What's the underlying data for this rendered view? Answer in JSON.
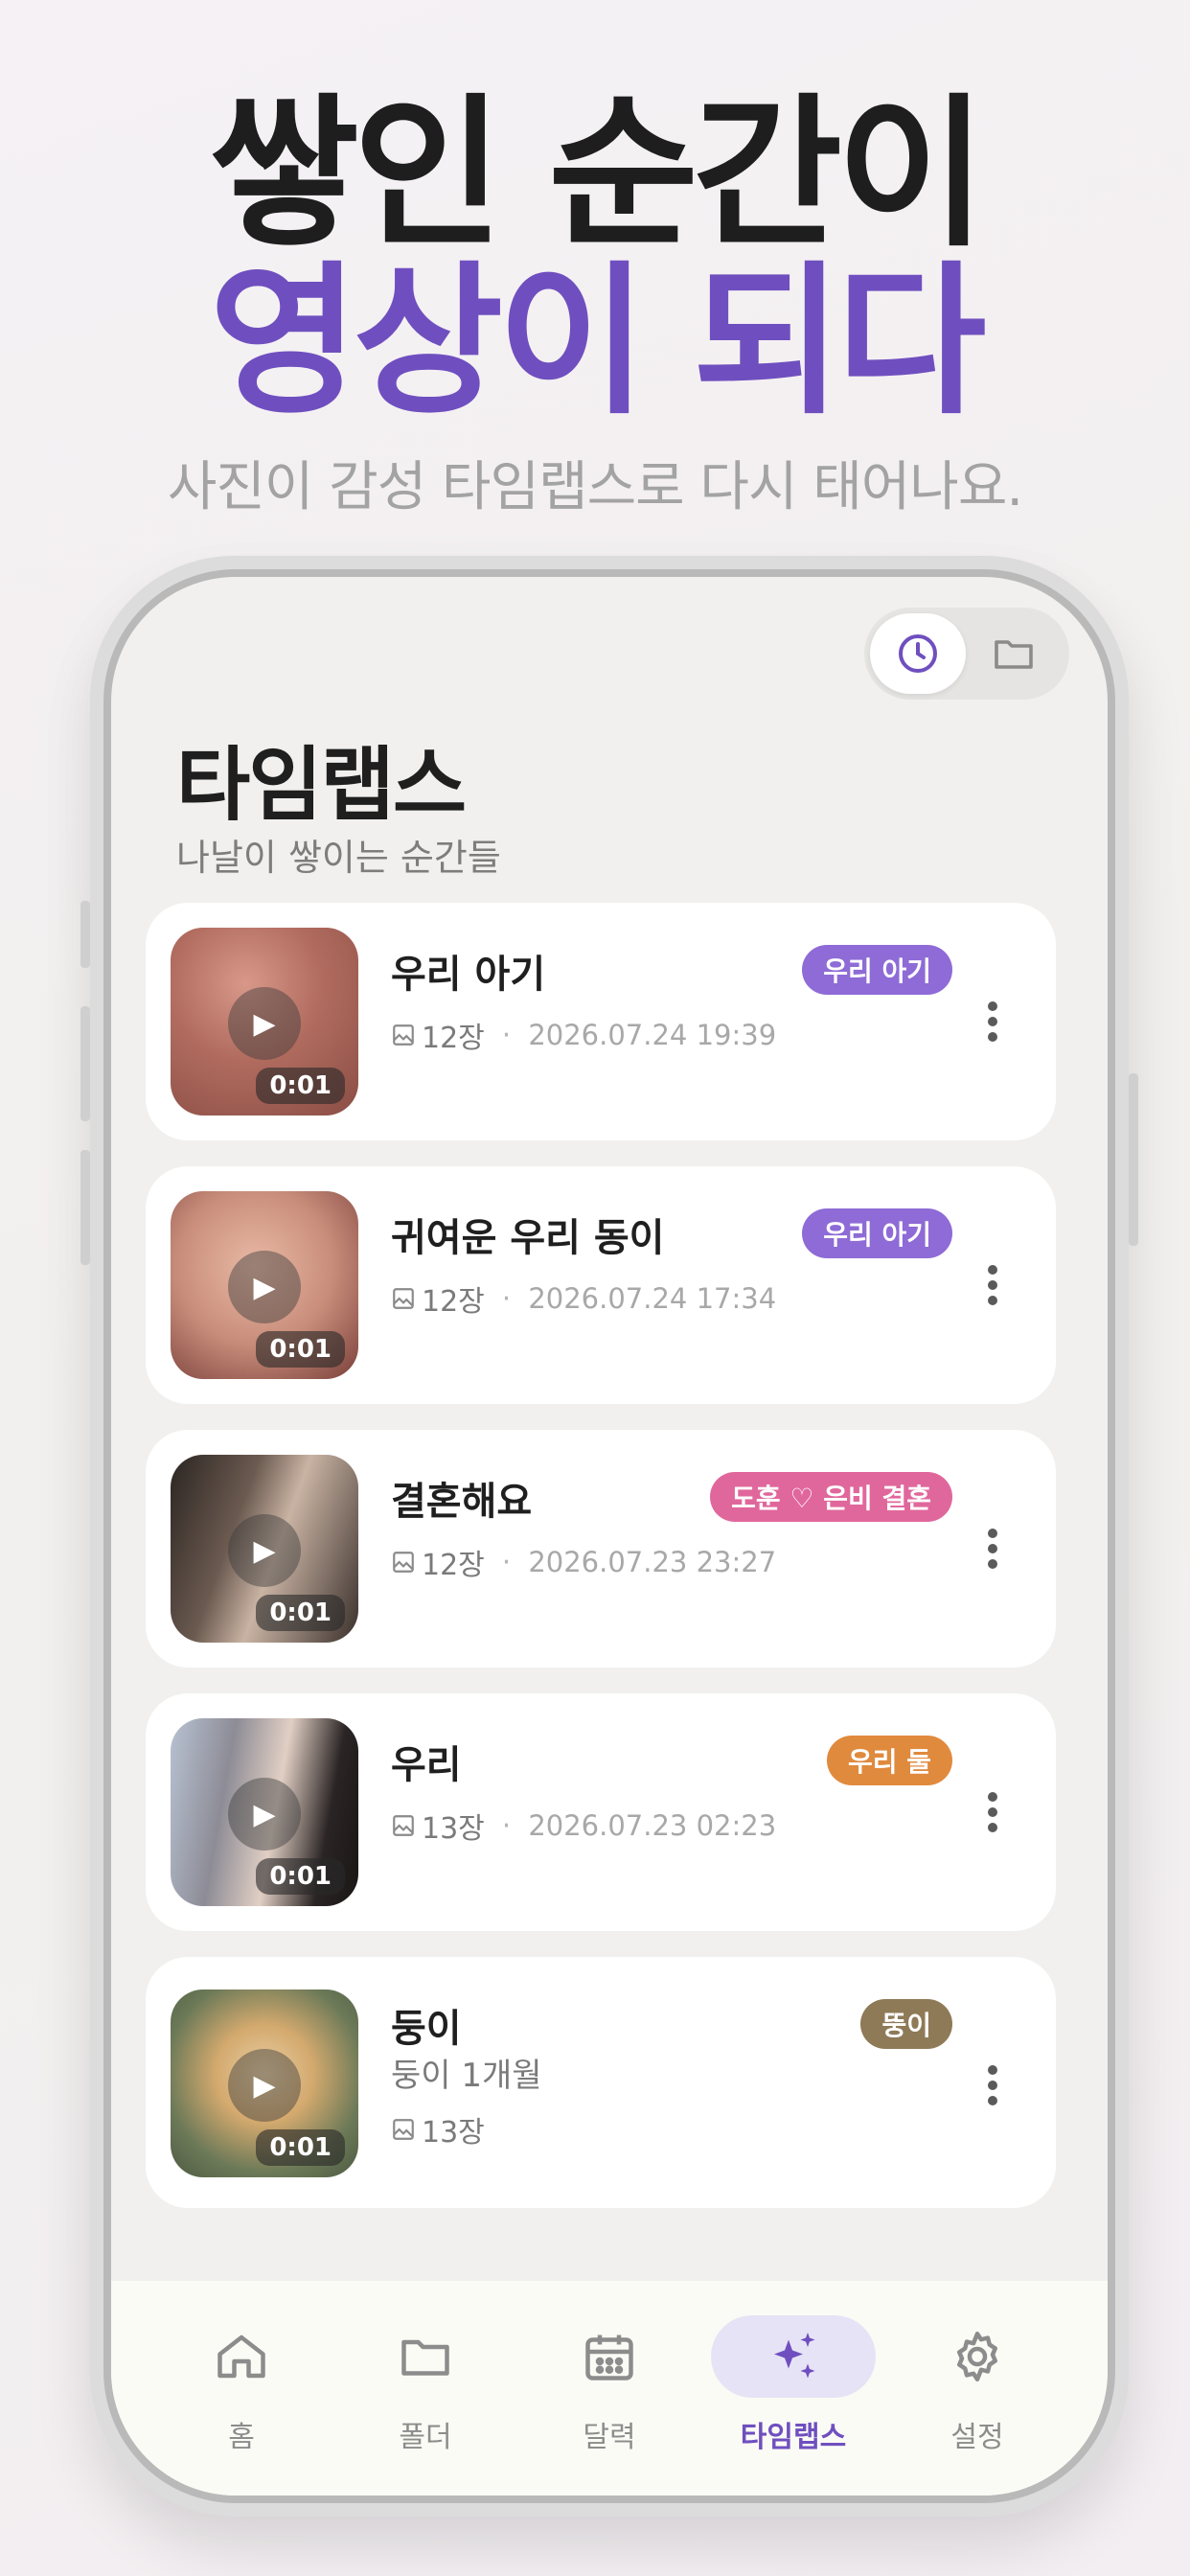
{
  "promo": {
    "line1": "쌓인 순간이",
    "line2": "영상이 되다",
    "subtitle": "사진이 감성 타임랩스로 다시 태어나요."
  },
  "view_toggle": {
    "active": "clock-icon",
    "inactive": "folder-icon"
  },
  "page": {
    "title": "타임랩스",
    "subtitle": "나날이 쌓이는 순간들"
  },
  "items": [
    {
      "title": "우리 아기",
      "tag": "우리 아기",
      "tag_color": "#8e6bd6",
      "count": "12장",
      "date": "2026.07.24 19:39",
      "duration": "0:01"
    },
    {
      "title": "귀여운 우리 동이",
      "tag": "우리 아기",
      "tag_color": "#8e6bd6",
      "count": "12장",
      "date": "2026.07.24 17:34",
      "duration": "0:01"
    },
    {
      "title": "결혼해요",
      "tag": "도훈 ♡ 은비 결혼",
      "tag_color": "#e0679c",
      "count": "12장",
      "date": "2026.07.23 23:27",
      "duration": "0:01"
    },
    {
      "title": "우리",
      "tag": "우리 둘",
      "tag_color": "#e08a3e",
      "count": "13장",
      "date": "2026.07.23 02:23",
      "duration": "0:01"
    },
    {
      "title": "둥이",
      "desc": "둥이 1개월",
      "tag": "뚱이",
      "tag_color": "#8f7a57",
      "count": "13장",
      "duration": "0:01"
    }
  ],
  "tabs": [
    {
      "label": "홈",
      "icon": "home-icon"
    },
    {
      "label": "폴더",
      "icon": "folder-icon"
    },
    {
      "label": "달력",
      "icon": "calendar-icon"
    },
    {
      "label": "타임랩스",
      "icon": "sparkle-icon",
      "active": true
    },
    {
      "label": "설정",
      "icon": "gear-icon"
    }
  ],
  "colors": {
    "accent": "#6f4fbf",
    "accent_soft": "#e7e3f6"
  }
}
